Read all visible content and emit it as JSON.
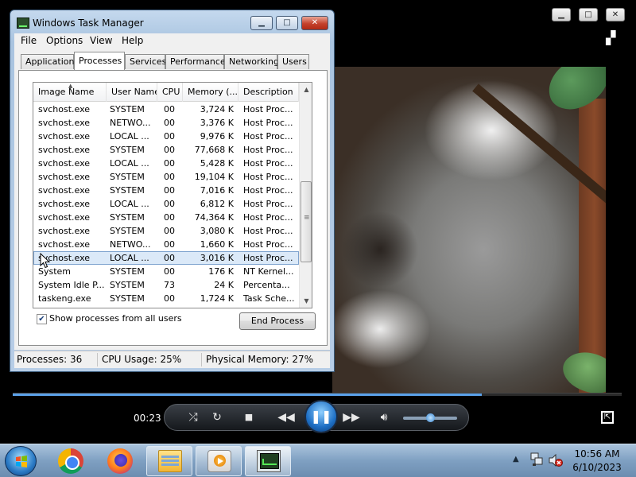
{
  "player": {
    "time": "00:23",
    "seek_fraction": 0.77,
    "volume_fraction": 0.5
  },
  "taskmanager": {
    "title": "Windows Task Manager",
    "menu": [
      "File",
      "Options",
      "View",
      "Help"
    ],
    "tabs": [
      "Applications",
      "Processes",
      "Services",
      "Performance",
      "Networking",
      "Users"
    ],
    "active_tab": "Processes",
    "columns": [
      "Image Name",
      "User Name",
      "CPU",
      "Memory (...",
      "Description"
    ],
    "rows": [
      [
        "svchost.exe",
        "SYSTEM",
        "00",
        "3,724 K",
        "Host Proc..."
      ],
      [
        "svchost.exe",
        "NETWO...",
        "00",
        "3,376 K",
        "Host Proc..."
      ],
      [
        "svchost.exe",
        "LOCAL ...",
        "00",
        "9,976 K",
        "Host Proc..."
      ],
      [
        "svchost.exe",
        "SYSTEM",
        "00",
        "77,668 K",
        "Host Proc..."
      ],
      [
        "svchost.exe",
        "LOCAL ...",
        "00",
        "5,428 K",
        "Host Proc..."
      ],
      [
        "svchost.exe",
        "SYSTEM",
        "00",
        "19,104 K",
        "Host Proc..."
      ],
      [
        "svchost.exe",
        "SYSTEM",
        "00",
        "7,016 K",
        "Host Proc..."
      ],
      [
        "svchost.exe",
        "LOCAL ...",
        "00",
        "6,812 K",
        "Host Proc..."
      ],
      [
        "svchost.exe",
        "SYSTEM",
        "00",
        "74,364 K",
        "Host Proc..."
      ],
      [
        "svchost.exe",
        "SYSTEM",
        "00",
        "3,080 K",
        "Host Proc..."
      ],
      [
        "svchost.exe",
        "NETWO...",
        "00",
        "1,660 K",
        "Host Proc..."
      ],
      [
        "svchost.exe",
        "LOCAL ...",
        "00",
        "3,016 K",
        "Host Proc..."
      ],
      [
        "System",
        "SYSTEM",
        "00",
        "176 K",
        "NT Kernel..."
      ],
      [
        "System Idle P...",
        "SYSTEM",
        "73",
        "24 K",
        "Percenta..."
      ],
      [
        "taskeng.exe",
        "SYSTEM",
        "00",
        "1,724 K",
        "Task Sche..."
      ]
    ],
    "selected_row": 11,
    "show_all_label": "Show processes from all users",
    "show_all_checked": true,
    "end_process_label": "End Process",
    "status": {
      "processes": "Processes: 36",
      "cpu": "CPU Usage: 25%",
      "memory": "Physical Memory: 27%"
    }
  },
  "taskbar": {
    "clock_time": "10:56 AM",
    "clock_date": "6/10/2023"
  }
}
